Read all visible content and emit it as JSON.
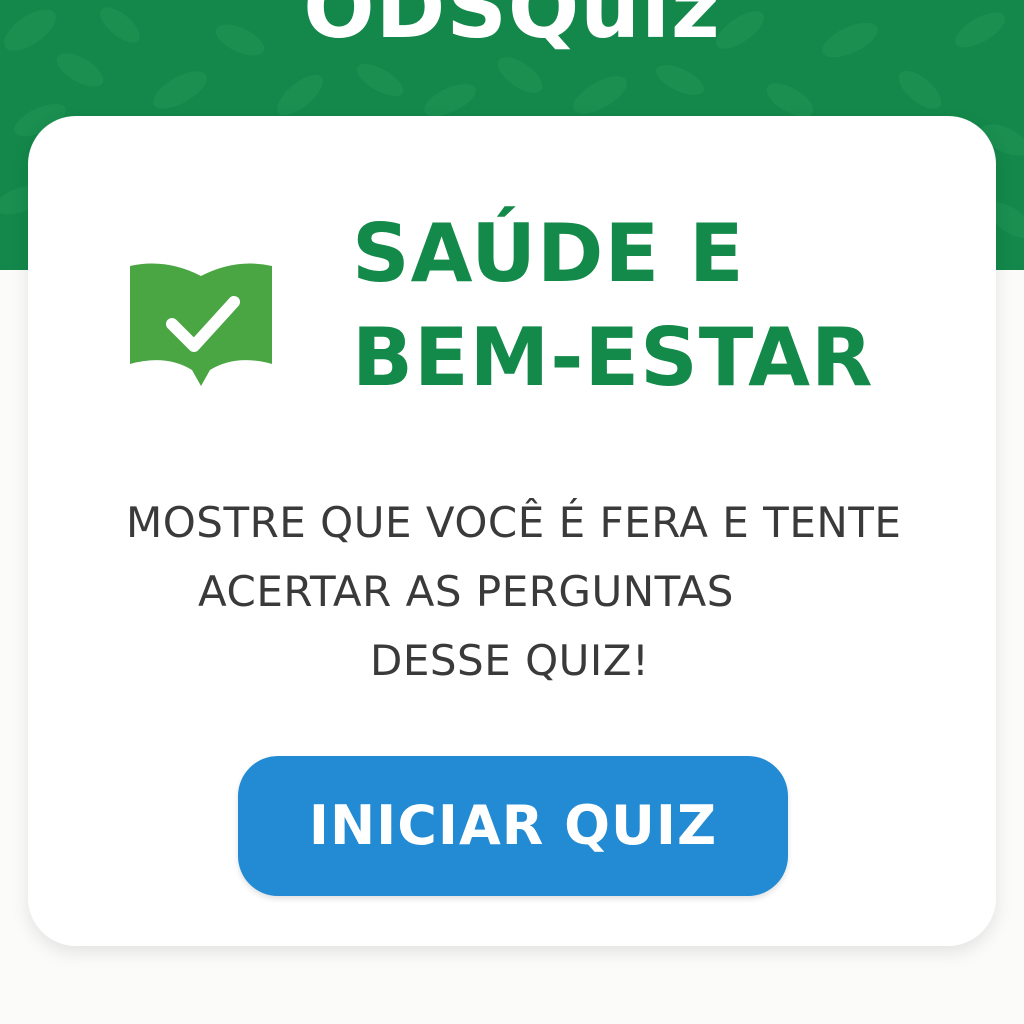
{
  "app": {
    "title": "ODSQuiz"
  },
  "topic": {
    "title_line1": "SAÚDE E",
    "title_line2": "BEM-ESTAR",
    "icon": "book-check-icon"
  },
  "intro": {
    "line1": "MOSTRE QUE VOCÊ É FERA E TENTE",
    "line2": "ACERTAR AS PERGUNTAS",
    "line3": "DESSE QUIZ!"
  },
  "actions": {
    "start_label": "INICIAR QUIZ"
  },
  "colors": {
    "header_green": "#14884a",
    "title_green": "#138a49",
    "icon_green": "#4aa642",
    "button_blue": "#238bd3",
    "text_gray": "#3a3a3a"
  }
}
